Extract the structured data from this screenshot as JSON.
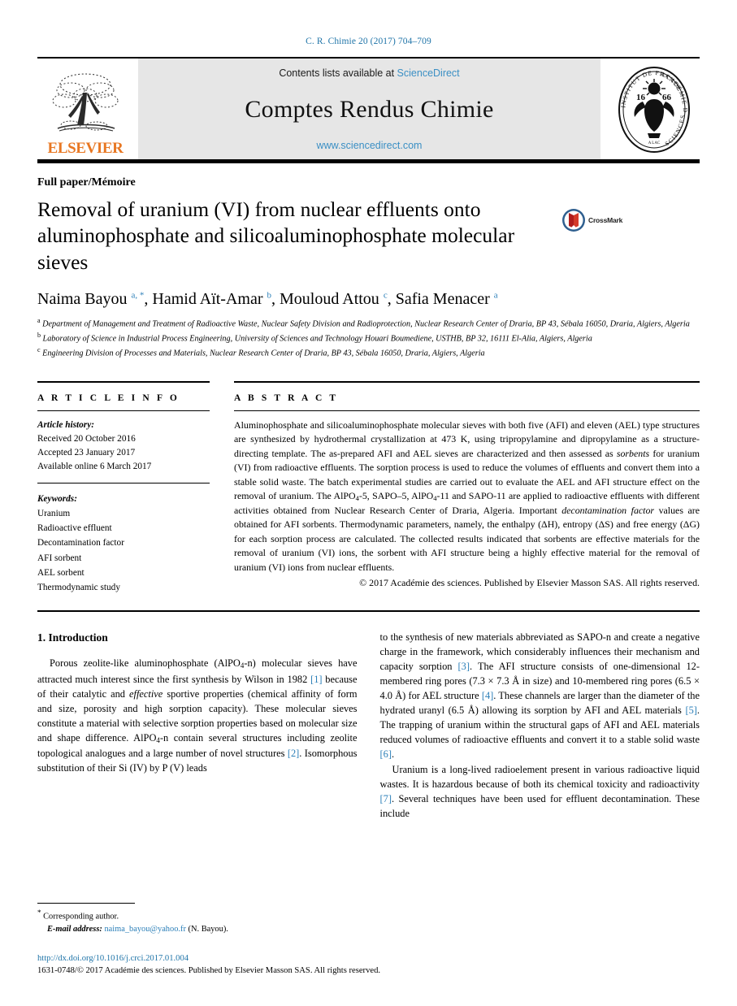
{
  "running_head": "C. R. Chimie 20 (2017) 704–709",
  "masthead": {
    "publisher_name": "ELSEVIER",
    "contents_prefix": "Contents lists available at ",
    "contents_link": "ScienceDirect",
    "journal_title": "Comptes Rendus Chimie",
    "journal_url": "www.sciencedirect.com",
    "seal_outer_text": "INSTITUT DE FRANCE · ACADÉMIE DES SCIENCES",
    "seal_year_left": "16",
    "seal_year_right": "66"
  },
  "article": {
    "kicker": "Full paper/Mémoire",
    "title": "Removal of uranium (VI) from nuclear effluents onto aluminophosphate and silicoaluminophosphate molecular sieves",
    "crossmark_label": "CrossMark",
    "authors_html": "Naima Bayou <sup>a, *</sup>, Hamid Aït-Amar <sup>b</sup>, Mouloud Attou <sup>c</sup>, Safia Menacer <sup>a</sup>",
    "affiliations": [
      {
        "marker": "a",
        "text": "Department of Management and Treatment of Radioactive Waste, Nuclear Safety Division and Radioprotection, Nuclear Research Center of Draria, BP 43, Sébala 16050, Draria, Algiers, Algeria"
      },
      {
        "marker": "b",
        "text": "Laboratory of Science in Industrial Process Engineering, University of Sciences and Technology Houari Boumediene, USTHB, BP 32, 16111 El-Alia, Algiers, Algeria"
      },
      {
        "marker": "c",
        "text": "Engineering Division of Processes and Materials, Nuclear Research Center of Draria, BP 43, Sébala 16050, Draria, Algiers, Algeria"
      }
    ]
  },
  "article_info": {
    "heading": "A R T I C L E   I N F O",
    "history_label": "Article history:",
    "history": [
      "Received 20 October 2016",
      "Accepted 23 January 2017",
      "Available online 6 March 2017"
    ],
    "keywords_label": "Keywords:",
    "keywords": [
      "Uranium",
      "Radioactive effluent",
      "Decontamination factor",
      "AFI sorbent",
      "AEL sorbent",
      "Thermodynamic study"
    ]
  },
  "abstract": {
    "heading": "A B S T R A C T",
    "body_html": "Aluminophosphate and silicoaluminophosphate molecular sieves with both five (AFI) and eleven (AEL) type structures are synthesized by hydrothermal crystallization at 473 K, using tripropylamine and dipropylamine as a structure-directing template. The as-prepared AFI and AEL sieves are characterized and then assessed as <i>sorbents</i> for uranium (VI) from radioactive effluents. The sorption process is used to reduce the volumes of effluents and convert them into a stable solid waste. The batch experimental studies are carried out to evaluate the AEL and AFI structure effect on the removal of uranium. The AlPO<sub>4</sub>-5, SAPO–5, AlPO<sub>4</sub>-11 and SAPO-11 are applied to radioactive effluents with different activities obtained from Nuclear Research Center of Draria, Algeria. Important <i>decontamination factor</i> values are obtained for AFI sorbents. Thermodynamic parameters, namely, the enthalpy (ΔH), entropy (ΔS) and free energy (ΔG) for each sorption process are calculated. The collected results indicated that sorbents are effective materials for the removal of uranium (VI) ions, the sorbent with AFI structure being a highly effective material for the removal of uranium (VI) ions from nuclear effluents.",
    "copyright": "© 2017 Académie des sciences. Published by Elsevier Masson SAS. All rights reserved."
  },
  "introduction": {
    "section_number_title": "1. Introduction",
    "left_column_html": "Porous zeolite-like aluminophosphate (AlPO<sub>4</sub>-n) molecular sieves have attracted much interest since the first synthesis by Wilson in 1982 <span class=\"ref\">[1]</span> because of their catalytic and <i>effective</i> sportive properties (chemical affinity of form and size, porosity and high sorption capacity). These molecular sieves constitute a material with selective sorption properties based on molecular size and shape difference. AlPO<sub>4</sub>-n contain several structures including zeolite topological analogues and a large number of novel structures <span class=\"ref\">[2]</span>. Isomorphous substitution of their Si (IV) by P (V) leads",
    "right_column_html": "to the synthesis of new materials abbreviated as SAPO-n and create a negative charge in the framework, which considerably influences their mechanism and capacity sorption <span class=\"ref\">[3]</span>. The AFI structure consists of one-dimensional 12-membered ring pores (7.3 × 7.3 Å in size) and 10-membered ring pores (6.5 × 4.0 Å) for AEL structure <span class=\"ref\">[4]</span>. These channels are larger than the diameter of the hydrated uranyl (6.5 Å) allowing its sorption by AFI and AEL materials <span class=\"ref\">[5]</span>. The trapping of uranium within the structural gaps of AFI and AEL materials reduced volumes of radioactive effluents and convert it to a stable solid waste <span class=\"ref\">[6]</span>.",
    "right_column_para2_html": "Uranium is a long-lived radioelement present in various radioactive liquid wastes. It is hazardous because of both its chemical toxicity and radioactivity <span class=\"ref\">[7]</span>. Several techniques have been used for effluent decontamination. These include"
  },
  "footnote": {
    "star": "*",
    "corresponding": "Corresponding author.",
    "email_label": "E-mail address:",
    "email": "naima_bayou@yahoo.fr",
    "email_suffix": "(N. Bayou)."
  },
  "footer": {
    "doi": "http://dx.doi.org/10.1016/j.crci.2017.01.004",
    "issn_line": "1631-0748/© 2017 Académie des sciences. Published by Elsevier Masson SAS. All rights reserved."
  },
  "colors": {
    "link_blue": "#2b7fb8",
    "header_blue": "#1f74a8",
    "elsevier_orange": "#E87722",
    "band_gray": "#e6e6e6"
  }
}
